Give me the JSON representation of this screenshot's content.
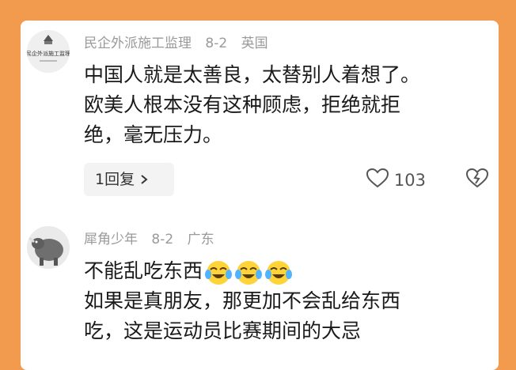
{
  "comments": [
    {
      "username": "民企外派施工监理",
      "date": "8-2",
      "location": "英国",
      "avatar_text": "民企外派施工监理",
      "lines": [
        "中国人就是太善良，太替别人着想了。",
        "欧美人根本没有这种顾虑，拒绝就拒",
        "绝，毫无压力。"
      ],
      "reply_label": "1回复",
      "like_count": "103"
    },
    {
      "username": "犀角少年",
      "date": "8-2",
      "location": "广东",
      "first_line": "不能乱吃东西",
      "emoji_count": 3,
      "lines": [
        "如果是真朋友，那更加不会乱给东西",
        "吃，这是运动员比赛期间的大忌"
      ]
    }
  ],
  "colors": {
    "frame": "#f29a4e",
    "meta": "#9a9a9a",
    "text": "#1a1a1a"
  },
  "icons": [
    "heart-icon",
    "dislike-heart-icon",
    "chevron-right-icon",
    "crying-laughing-emoji"
  ]
}
